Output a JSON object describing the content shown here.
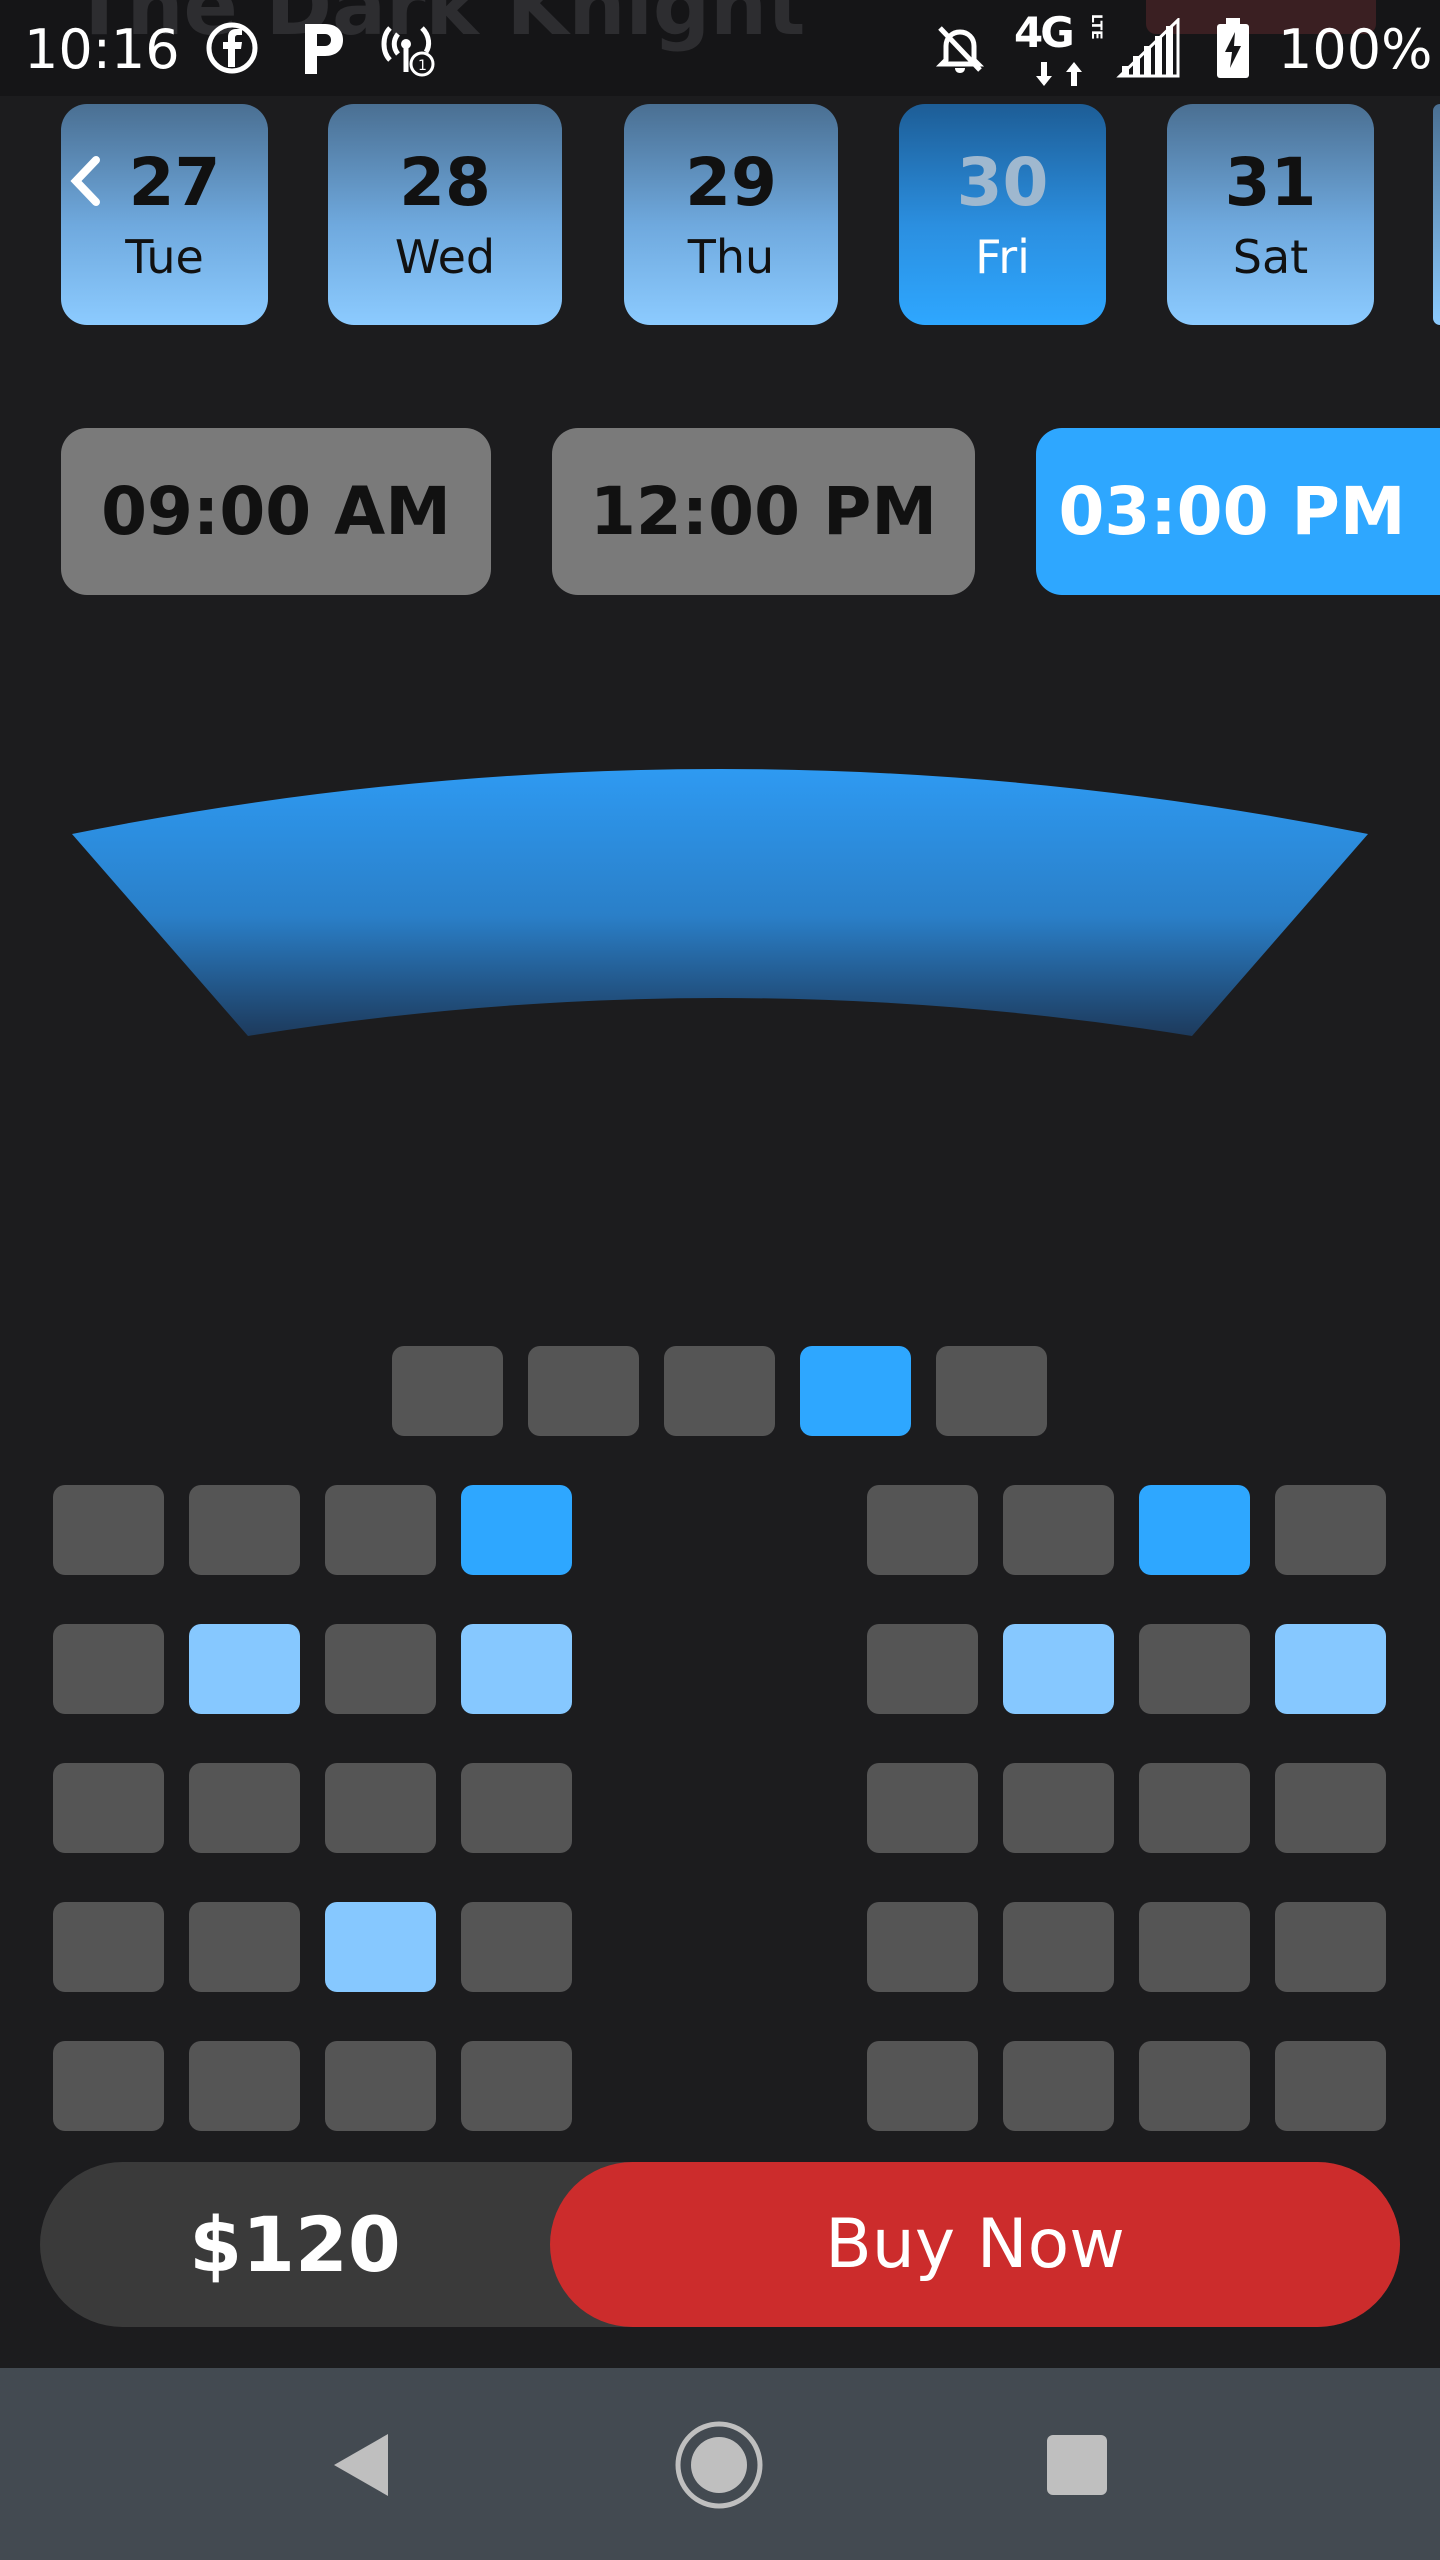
{
  "status_bar": {
    "time": "10:16",
    "network": "4G",
    "network_sub": "LTE",
    "battery": "100%",
    "background_title": "The Dark Knight",
    "icons": [
      "facebook-icon",
      "parking-icon",
      "hotspot-icon",
      "bell-off-icon",
      "network-arrows-icon",
      "signal-icon",
      "battery-charging-icon"
    ]
  },
  "dates": [
    {
      "num": "27",
      "dow": "Tue"
    },
    {
      "num": "28",
      "dow": "Wed"
    },
    {
      "num": "29",
      "dow": "Thu"
    },
    {
      "num": "30",
      "dow": "Fri",
      "selected": true
    },
    {
      "num": "31",
      "dow": "Sat"
    }
  ],
  "times": [
    {
      "label": "09:00 AM"
    },
    {
      "label": "12:00 PM"
    },
    {
      "label": "03:00 PM",
      "selected": true
    }
  ],
  "seat_map": {
    "top_row": [
      "empty",
      "empty",
      "empty",
      "chosen",
      "empty"
    ],
    "left_block": [
      [
        "empty",
        "empty",
        "empty",
        "chosen"
      ],
      [
        "empty",
        "reserved",
        "empty",
        "reserved"
      ],
      [
        "empty",
        "empty",
        "empty",
        "empty"
      ],
      [
        "empty",
        "empty",
        "reserved",
        "empty"
      ],
      [
        "empty",
        "empty",
        "empty",
        "empty"
      ]
    ],
    "right_block": [
      [
        "empty",
        "empty",
        "chosen",
        "empty"
      ],
      [
        "empty",
        "reserved",
        "empty",
        "reserved"
      ],
      [
        "empty",
        "empty",
        "empty",
        "empty"
      ],
      [
        "empty",
        "empty",
        "empty",
        "empty"
      ],
      [
        "empty",
        "empty",
        "empty",
        "empty"
      ]
    ]
  },
  "checkout": {
    "price": "$120",
    "buy_label": "Buy Now"
  },
  "colors": {
    "accent": "#2ea7ff",
    "reserved": "#86c8ff",
    "seat": "#555555",
    "buy": "#cc2c2c",
    "background": "#1c1c1e",
    "nav": "#434a51"
  },
  "nav": {
    "icons": [
      "back-icon",
      "home-icon",
      "recents-icon"
    ]
  }
}
